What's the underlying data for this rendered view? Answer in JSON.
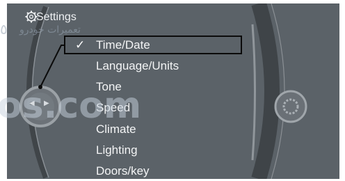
{
  "header": {
    "title": "Settings",
    "icon": "gear-icon"
  },
  "menu": {
    "items": [
      {
        "label": "Time/Date",
        "selected": true
      },
      {
        "label": "Language/Units"
      },
      {
        "label": "Tone"
      },
      {
        "label": "Speed"
      },
      {
        "label": "Climate"
      },
      {
        "label": "Lighting"
      },
      {
        "label": "Doors/key"
      }
    ],
    "check_glyph": "✓"
  },
  "controller": {
    "left_arrow": "◀",
    "right_arrow": "▶"
  },
  "watermark": {
    "arabic_text": "تعمیرات خودرو",
    "arabic_number": "٥",
    "latin_text": "os.com"
  },
  "colors": {
    "screen_bg": "#5b6268",
    "text": "#f3f4f5",
    "highlight_border": "#0b0b0b"
  }
}
